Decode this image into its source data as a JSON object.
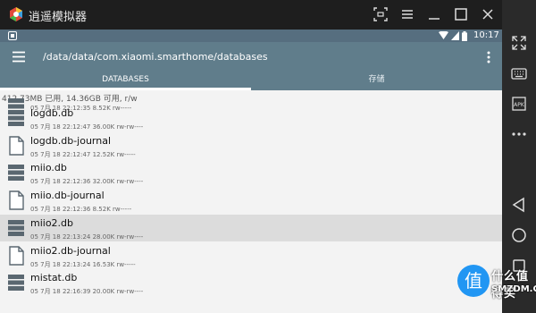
{
  "window": {
    "title": "逍遥模拟器"
  },
  "statusbar": {
    "time": "10:17"
  },
  "toolbar": {
    "path": "/data/data/com.xiaomi.smarthome/databases"
  },
  "tabs": [
    {
      "label": "DATABASES",
      "active": true
    },
    {
      "label": "存储",
      "active": false
    }
  ],
  "storage_info": "412.73MB 已用, 14.36GB 可用, r/w",
  "files": [
    {
      "name": "",
      "meta": "05 7月 18 22:12:35  8.52K  rw-----",
      "type": "db",
      "partial": true
    },
    {
      "name": "logdb.db",
      "meta": "05 7月 18 22:12:47  36.00K  rw-rw----",
      "type": "db"
    },
    {
      "name": "logdb.db-journal",
      "meta": "05 7月 18 22:12:47  12.52K  rw-----",
      "type": "doc"
    },
    {
      "name": "miio.db",
      "meta": "05 7月 18 22:12:36  32.00K  rw-rw----",
      "type": "db"
    },
    {
      "name": "miio.db-journal",
      "meta": "05 7月 18 22:12:36  8.52K  rw-----",
      "type": "doc"
    },
    {
      "name": "miio2.db",
      "meta": "05 7月 18 22:13:24  28.00K  rw-rw----",
      "type": "db",
      "selected": true
    },
    {
      "name": "miio2.db-journal",
      "meta": "05 7月 18 22:13:24  16.53K  rw-----",
      "type": "doc"
    },
    {
      "name": "mistat.db",
      "meta": "05 7月 18 22:16:39  20.00K  rw-rw----",
      "type": "db"
    }
  ],
  "sidebar": {
    "items": [
      "expand-icon",
      "keyboard-icon",
      "apk-install-icon",
      "more-options-icon",
      "back-icon",
      "home-icon",
      "recents-icon"
    ]
  },
  "watermark": {
    "glyph": "值",
    "line1": "什么值得买",
    "line2": "SMZDM.COM"
  },
  "colors": {
    "toolbar": "#607d8b",
    "statusbar": "#566e7f",
    "window_bg": "#1e1e1e"
  }
}
